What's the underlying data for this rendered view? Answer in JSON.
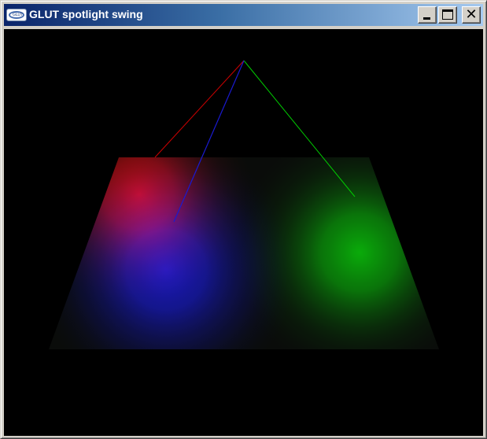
{
  "window": {
    "title": "GLUT spotlight swing",
    "icon": "glut-app-icon",
    "icon_text": "GLUT",
    "controls": {
      "minimize": "minimize-icon",
      "maximize": "maximize-icon",
      "close": "close-icon",
      "close_glyph": "✕"
    }
  },
  "scene": {
    "background": "#000000",
    "floor_base_color": "#0c0c0c",
    "lights": [
      {
        "name": "red-spotlight",
        "color": "#cc0000"
      },
      {
        "name": "green-spotlight",
        "color": "#00cc00"
      },
      {
        "name": "blue-spotlight",
        "color": "#0000cc"
      }
    ]
  },
  "colors": {
    "titlebar_start": "#0a246a",
    "titlebar_end": "#a6caf0",
    "title_text": "#ffffff",
    "frame": "#d4d0c8"
  }
}
